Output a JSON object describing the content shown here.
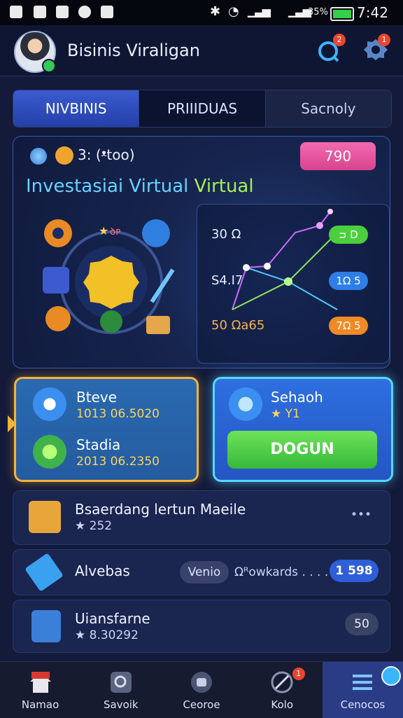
{
  "status_bar": {
    "battery": "35%",
    "time": "7:42"
  },
  "header": {
    "title": "Bisinis Viraligan",
    "notifications_badge": "2",
    "settings_badge": "1"
  },
  "tabs": [
    "NIVBINIS",
    "PRIIIDUAS",
    "Sacnoly"
  ],
  "hero": {
    "meta": "3: (ᵜtoo)",
    "pill": "790",
    "title_a": "Investasiai Virtual",
    "title_b": "Virtual",
    "graph": {
      "labels": [
        "30 Ω",
        "S4.I7",
        "50 Ωa65"
      ],
      "pills": [
        "ᴝ D",
        "1Ω 5",
        "7Ω 5"
      ],
      "pill_colors": [
        "#4ccf3d",
        "#2d7ee8",
        "#f08a26"
      ]
    }
  },
  "cards": {
    "left": {
      "item1_title": "Bteve",
      "item1_value": "1013 06.5020",
      "item2_title": "Stadia",
      "item2_value": "2013 06.2350"
    },
    "right": {
      "title": "Sehaoh",
      "sub": "★ Y1",
      "cta": "DOGUN"
    }
  },
  "list": [
    {
      "title": "Bsaerdang lertun Maeile",
      "sub": "★ 252",
      "more": "•••"
    },
    {
      "title": "Alvebas",
      "chip1": "Venio",
      "mid": "Ωᴿowkards . . . .",
      "chip2": "1 598"
    },
    {
      "title": "Uiansfarne",
      "sub": "★ 8.30292",
      "chip": "50"
    }
  ],
  "bottom_nav": [
    "Namao",
    "Savoik",
    "Ceoroe",
    "Kolo",
    "Cenocos"
  ],
  "bottom_nav_badge": "1",
  "colors": {
    "accent_blue": "#2e6fe0",
    "accent_green": "#36b83a",
    "accent_yellow": "#f3b43a",
    "accent_pink": "#d8448f"
  }
}
